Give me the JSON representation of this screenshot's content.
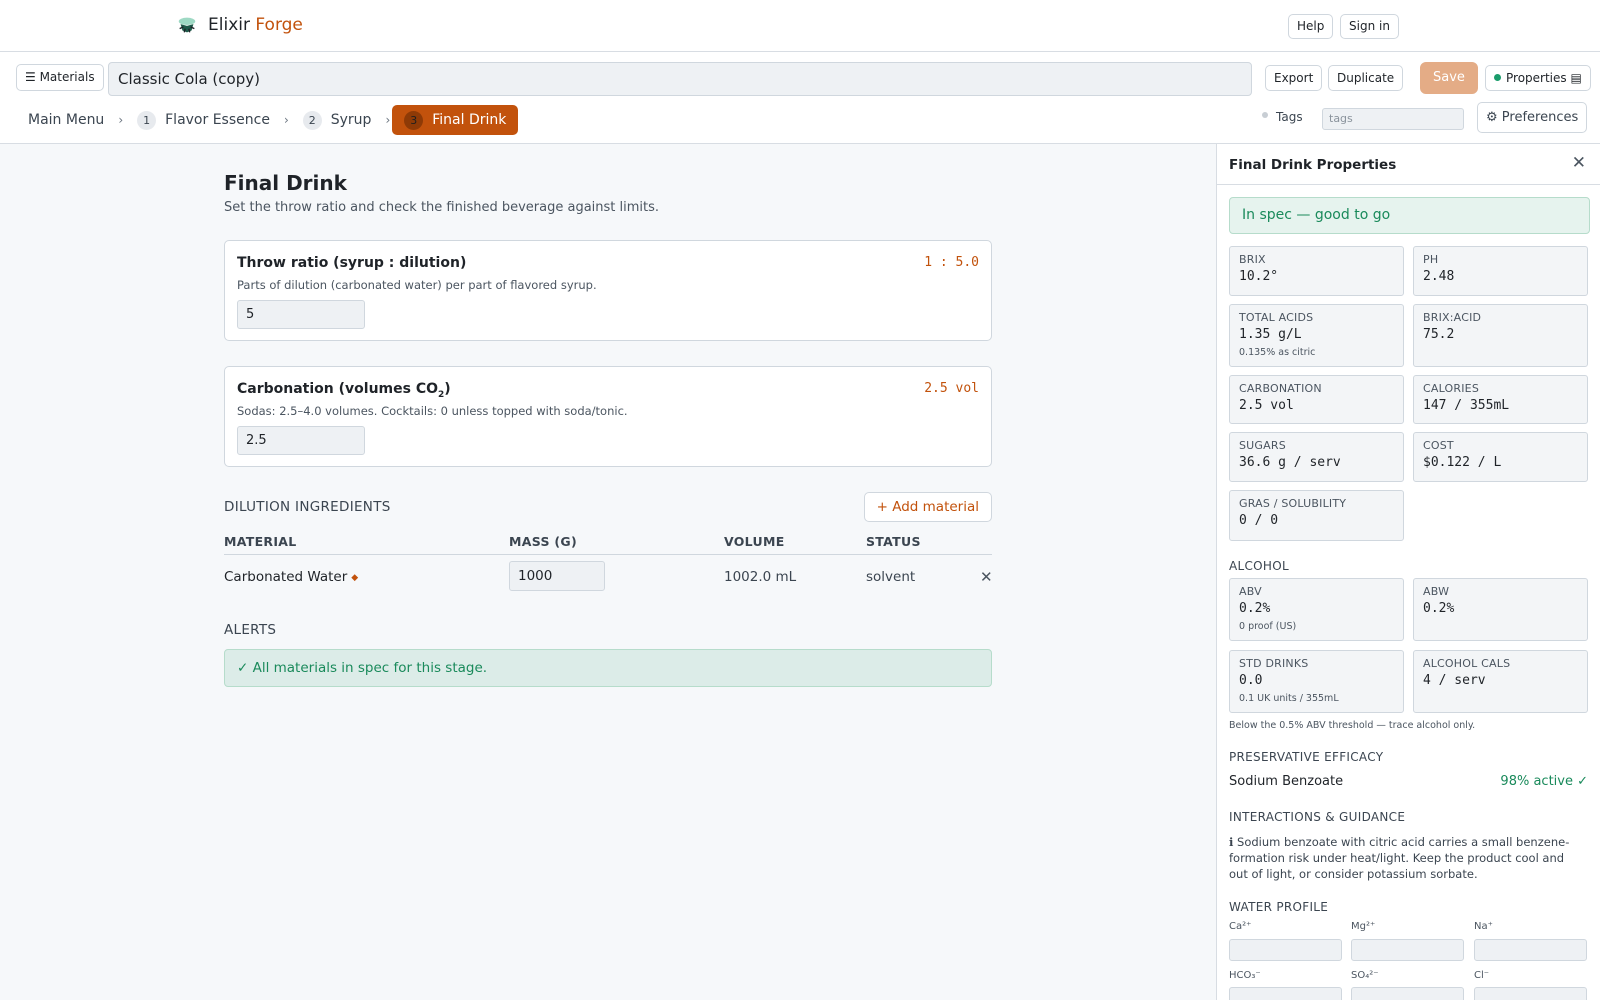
{
  "app": {
    "brand_part1": "Elixir",
    "brand_part2": "Forge",
    "accent": "#c2520c",
    "ok_color": "#1a8a5b"
  },
  "topnav": {
    "help": "Help",
    "signin": "Sign in"
  },
  "toolbar": {
    "materials": "☰ Materials",
    "recipe_name": "Classic Cola (copy)",
    "export": "Export",
    "duplicate": "Duplicate",
    "save": "Save",
    "properties": "Properties ▤"
  },
  "breadcrumbs": {
    "main_menu": "Main Menu",
    "steps": [
      {
        "num": "1",
        "label": "Flavor Essence"
      },
      {
        "num": "2",
        "label": "Syrup"
      },
      {
        "num": "3",
        "label": "Final Drink"
      }
    ],
    "separator": "›"
  },
  "tags": {
    "label": "Tags",
    "placeholder": "tags"
  },
  "preferences": "⚙ Preferences",
  "main": {
    "title": "Final Drink",
    "subtitle": "Set the throw ratio and check the finished beverage against limits.",
    "throw": {
      "title": "Throw ratio (syrup : dilution)",
      "value_display": "1 : 5.0",
      "desc": "Parts of dilution (carbonated water) per part of flavored syrup.",
      "input": "5"
    },
    "carbonation": {
      "title_pre": "Carbonation (volumes CO",
      "title_sub": "2",
      "title_post": ")",
      "value_display": "2.5 vol",
      "desc": "Sodas: 2.5–4.0 volumes. Cocktails: 0 unless topped with soda/tonic.",
      "input": "2.5"
    },
    "dilution_title": "DILUTION INGREDIENTS",
    "add_material": "+ Add material",
    "columns": {
      "material": "MATERIAL",
      "mass": "MASS (G)",
      "volume": "VOLUME",
      "status": "STATUS"
    },
    "rows": [
      {
        "material": "Carbonated Water",
        "mass": "1000",
        "volume": "1002.0 mL",
        "status": "solvent"
      }
    ],
    "alerts_title": "ALERTS",
    "alert_ok": "✓ All materials in spec for this stage."
  },
  "panel": {
    "title": "Final Drink Properties",
    "status": "In spec — good to go",
    "stats": [
      {
        "label": "BRIX",
        "value": "10.2°"
      },
      {
        "label": "PH",
        "value": "2.48"
      },
      {
        "label": "TOTAL ACIDS",
        "value": "1.35 g/L",
        "note": "0.135% as citric"
      },
      {
        "label": "BRIX:ACID",
        "value": "75.2"
      },
      {
        "label": "CARBONATION",
        "value": "2.5 vol"
      },
      {
        "label": "CALORIES",
        "value": "147 / 355mL"
      },
      {
        "label": "SUGARS",
        "value": "36.6 g / serv"
      },
      {
        "label": "COST",
        "value": "$0.122 / L"
      },
      {
        "label": "GRAS / SOLUBILITY",
        "value": "0 / 0"
      }
    ],
    "alcohol_title": "ALCOHOL",
    "alcohol": [
      {
        "label": "ABV",
        "value": "0.2%",
        "note": "0 proof (US)"
      },
      {
        "label": "ABW",
        "value": "0.2%"
      },
      {
        "label": "STD DRINKS",
        "value": "0.0",
        "note": "0.1 UK units / 355mL"
      },
      {
        "label": "ALCOHOL CALS",
        "value": "4 / serv"
      }
    ],
    "alcohol_note": "Below the 0.5% ABV threshold — trace alcohol only.",
    "preservative_title": "PRESERVATIVE EFFICACY",
    "preservative_name": "Sodium Benzoate",
    "preservative_value": "98% active ✓",
    "interactions_title": "INTERACTIONS & GUIDANCE",
    "interactions_text": "ℹ Sodium benzoate with citric acid carries a small benzene-formation risk under heat/light. Keep the product cool and out of light, or consider potassium sorbate.",
    "water_title": "WATER PROFILE",
    "water": [
      {
        "label": "Ca²⁺"
      },
      {
        "label": "Mg²⁺"
      },
      {
        "label": "Na⁺"
      },
      {
        "label": "HCO₃⁻"
      },
      {
        "label": "SO₄²⁻"
      },
      {
        "label": "Cl⁻"
      }
    ]
  }
}
